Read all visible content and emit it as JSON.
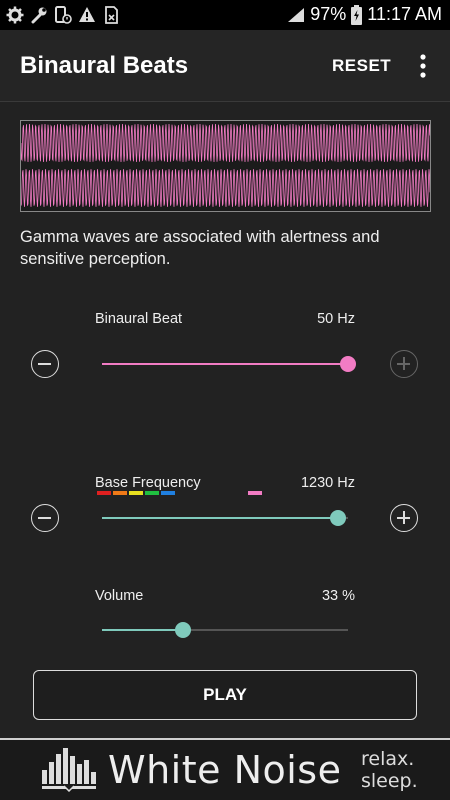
{
  "status_bar": {
    "battery": "97%",
    "time": "11:17 AM"
  },
  "app_bar": {
    "title": "Binaural Beats",
    "reset_label": "RESET"
  },
  "description": "Gamma waves are associated with alertness and sensitive perception.",
  "controls": {
    "binaural_beat": {
      "label": "Binaural Beat",
      "value": "50 Hz",
      "fraction": 1.0,
      "color": "#f27cc4"
    },
    "base_frequency": {
      "label": "Base Frequency",
      "value": "1230 Hz",
      "fraction": 0.96,
      "color": "#7fcabc"
    },
    "volume": {
      "label": "Volume",
      "value": "33 %",
      "fraction": 0.33,
      "color": "#7fcabc"
    }
  },
  "band_colors": [
    "#e02020",
    "#f07a18",
    "#e8e020",
    "#20c040",
    "#2080e0"
  ],
  "active_band_color": "#f27cc4",
  "play_label": "PLAY",
  "banner": {
    "title": "White Noise",
    "tagline_1": "relax.",
    "tagline_2": "sleep."
  }
}
